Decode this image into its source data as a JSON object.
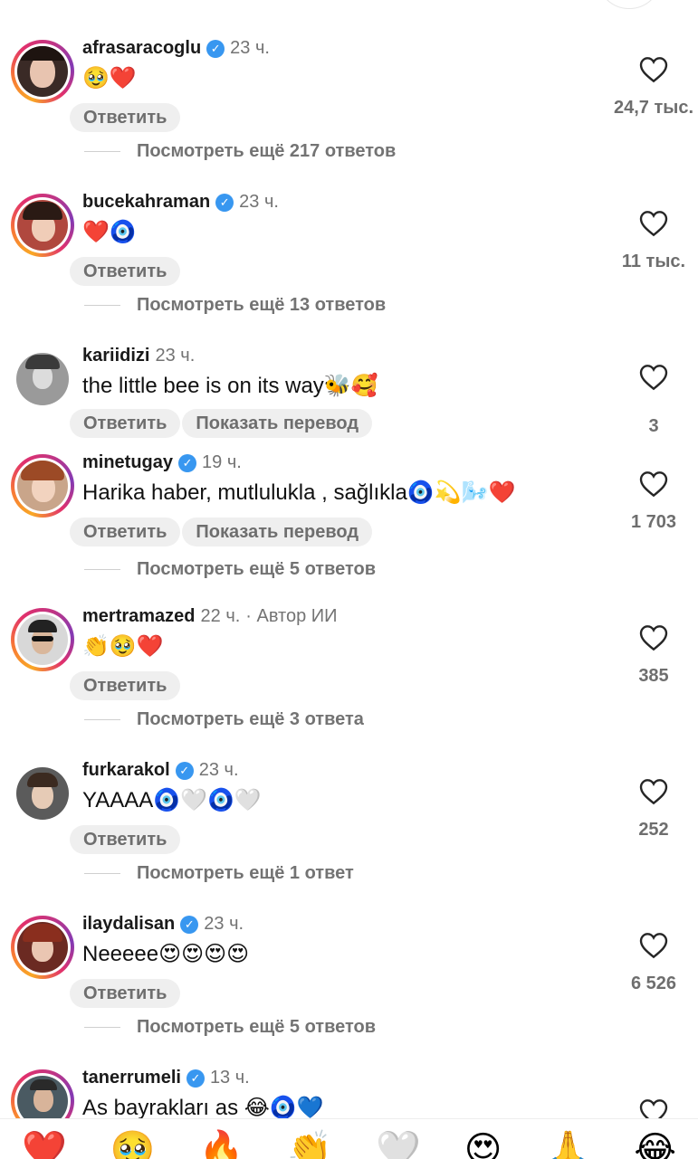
{
  "reply_label": "Ответить",
  "translate_label": "Показать перевод",
  "author_label": "Автор ИИ",
  "comments": [
    {
      "username": "afrasaracoglu",
      "verified": true,
      "time": "23 ч.",
      "text": "🥹❤️",
      "likes": "24,7 тыс.",
      "replies": "Посмотреть ещё 217 ответов"
    },
    {
      "username": "bucekahraman",
      "verified": true,
      "time": "23 ч.",
      "text": "❤️🧿",
      "likes": "11 тыс.",
      "replies": "Посмотреть ещё 13 ответов"
    },
    {
      "username": "kariidizi",
      "verified": false,
      "time": "23 ч.",
      "text": "the little bee is on its way🐝🥰",
      "likes": "3",
      "replies": ""
    },
    {
      "username": "minetugay",
      "verified": true,
      "time": "19 ч.",
      "text": "Harika haber, mutlulukla , sağlıkla🧿💫🌬️❤️",
      "likes": "1 703",
      "replies": "Посмотреть ещё 5 ответов"
    },
    {
      "username": "mertramazed",
      "verified": false,
      "time": "22 ч.",
      "text": "👏🥹❤️",
      "likes": "385",
      "replies": "Посмотреть ещё 3 ответа"
    },
    {
      "username": "furkarakol",
      "verified": true,
      "time": "23 ч.",
      "text": "YAAAA🧿🤍🧿🤍",
      "likes": "252",
      "replies": "Посмотреть ещё 1 ответ"
    },
    {
      "username": "ilaydalisan",
      "verified": true,
      "time": "23 ч.",
      "text": "Neeeee😍😍😍😍",
      "likes": "6 526",
      "replies": "Посмотреть ещё 5 ответов"
    },
    {
      "username": "tanerrumeli",
      "verified": true,
      "time": "13 ч.",
      "text": "As bayrakları as 😂🧿💙",
      "likes": "",
      "replies": ""
    }
  ],
  "quick_reactions": [
    "❤️",
    "🥹",
    "🔥",
    "👏",
    "🤍",
    "😍",
    "🙏",
    "😂"
  ]
}
